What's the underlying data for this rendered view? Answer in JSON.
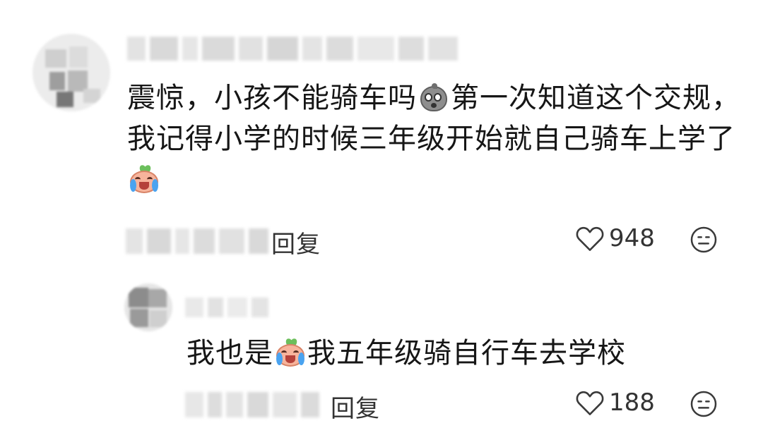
{
  "comments": [
    {
      "text_line1_a": "震惊，小孩不能骑车吗",
      "emoji_1": "shocked-blob-emoji",
      "text_line1_b": "第一次知道这个交规，",
      "text_line2": "我记得小学的时候三年级开始就自己骑车上学了",
      "emoji_2": "crying-laugh-emoji",
      "reply_label": "回复",
      "like_count": "948"
    },
    {
      "text_a": "我也是",
      "emoji": "crying-laugh-emoji",
      "text_b": "我五年级骑自行车去学校",
      "reply_label": "回复",
      "like_count": "188"
    }
  ],
  "icons": {
    "like": "heart-outline-icon",
    "dislike": "neutral-face-icon"
  },
  "colors": {
    "text": "#161616",
    "muted": "#333333",
    "icon": "#3a3a3a"
  }
}
